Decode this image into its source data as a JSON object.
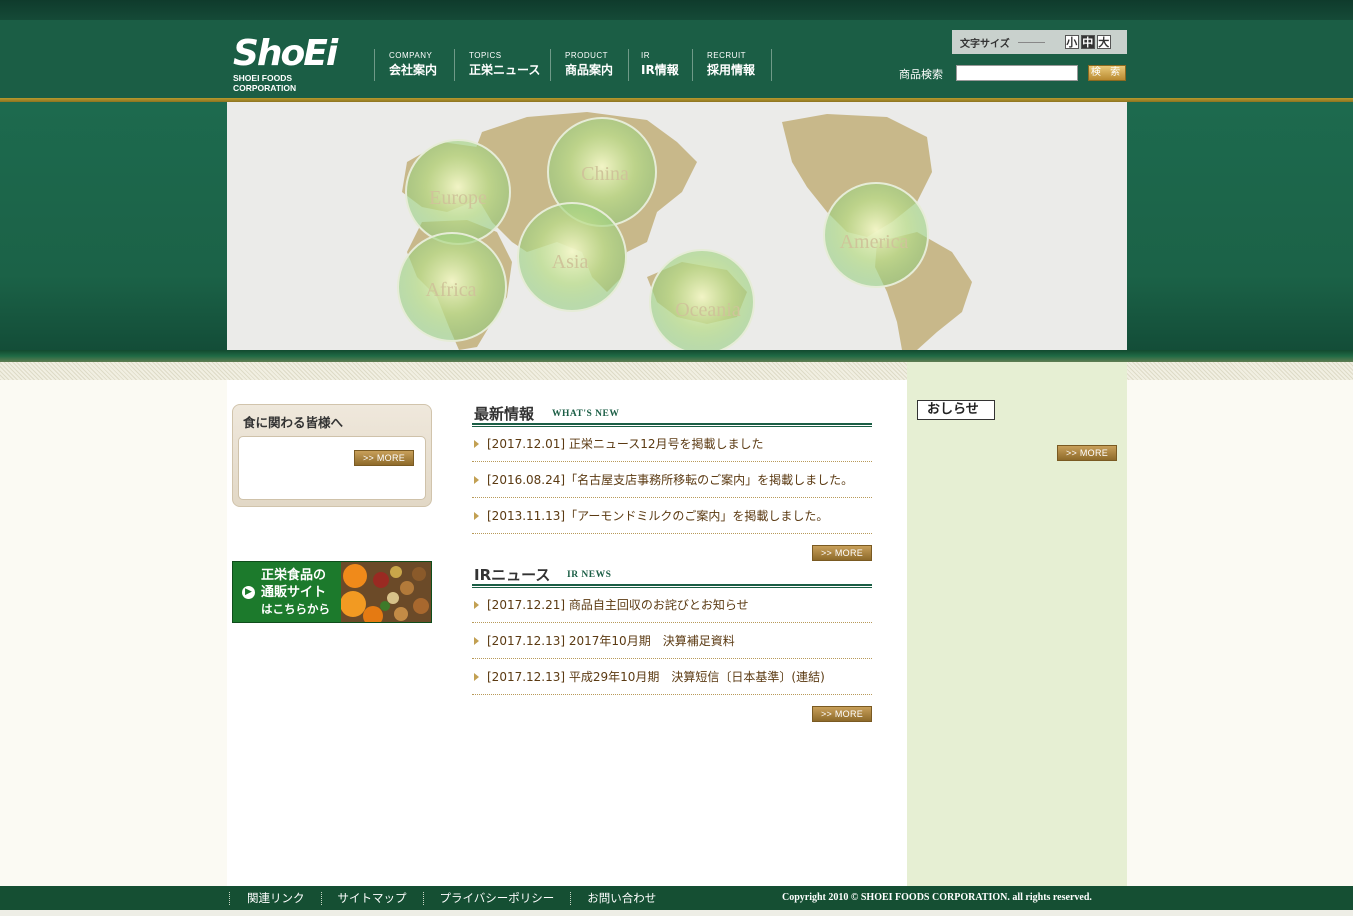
{
  "header": {
    "logo_text": "ShoEi",
    "logo_sub": "SHOEI FOODS CORPORATION",
    "nav": [
      {
        "en": "COMPANY",
        "ja": "会社案内"
      },
      {
        "en": "TOPICS",
        "ja": "正栄ニュース"
      },
      {
        "en": "PRODUCT",
        "ja": "商品案内"
      },
      {
        "en": "IR",
        "ja": "IR情報"
      },
      {
        "en": "RECRUIT",
        "ja": "採用情報"
      }
    ],
    "font_size_label": "文字サイズ",
    "font_sizes": [
      "小",
      "中",
      "大"
    ],
    "search_label": "商品検索",
    "search_value": "",
    "search_button": "検 索"
  },
  "hero": {
    "regions": [
      "Europe",
      "China",
      "America",
      "Asia",
      "Africa",
      "Oceania"
    ]
  },
  "left": {
    "promo_title": "食に関わる皆様へ",
    "more_label": ">> MORE",
    "shop_banner": {
      "line1": "正栄食品の",
      "line2": "通販サイト",
      "line3": "はこちらから"
    }
  },
  "whats_new": {
    "title_ja": "最新情報",
    "title_en": "WHAT'S NEW",
    "items": [
      "[2017.12.01] 正栄ニュース12月号を掲載しました",
      "[2016.08.24]「名古屋支店事務所移転のご案内」を掲載しました。",
      "[2013.11.13]「アーモンドミルクのご案内」を掲載しました。"
    ],
    "more_label": ">> MORE"
  },
  "ir_news": {
    "title_ja": "IRニュース",
    "title_en": "IR NEWS",
    "items": [
      "[2017.12.21] 商品自主回収のお詫びとお知らせ",
      "[2017.12.13] 2017年10月期　決算補足資料",
      "[2017.12.13] 平成29年10月期　決算短信〔日本基準〕(連結)"
    ],
    "more_label": ">> MORE"
  },
  "right": {
    "notice_label": "おしらせ",
    "more_label": ">> MORE"
  },
  "footer": {
    "links": [
      "関連リンク",
      "サイトマップ",
      "プライバシーポリシー",
      "お問い合わせ"
    ],
    "copyright": "Copyright 2010 © SHOEI FOODS CORPORATION. all rights reserved."
  },
  "colors": {
    "brand_green": "#1b5e45",
    "gold": "#b89a2c",
    "news_text": "#5b3a12"
  }
}
